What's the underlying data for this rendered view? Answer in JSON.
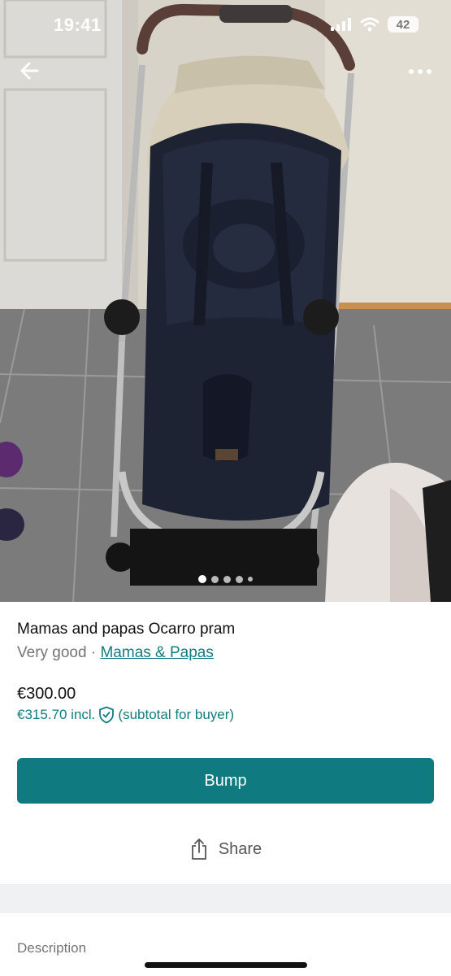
{
  "status_bar": {
    "time": "19:41",
    "battery": "42"
  },
  "carousel": {
    "image_count": 5,
    "active_index": 0
  },
  "listing": {
    "title": "Mamas and papas Ocarro pram",
    "condition": "Very good",
    "separator": " · ",
    "brand": "Mamas & Papas",
    "price": "€300.00",
    "buyer_price": "€315.70 incl.",
    "buyer_note": "(subtotal for buyer)"
  },
  "actions": {
    "bump_label": "Bump",
    "share_label": "Share"
  },
  "sections": {
    "description_label": "Description"
  },
  "colors": {
    "accent": "#0f7a80",
    "link": "#127c82"
  },
  "icons": [
    "back-arrow-icon",
    "more-icon",
    "shield-check-icon",
    "share-icon",
    "signal-icon",
    "wifi-icon"
  ]
}
